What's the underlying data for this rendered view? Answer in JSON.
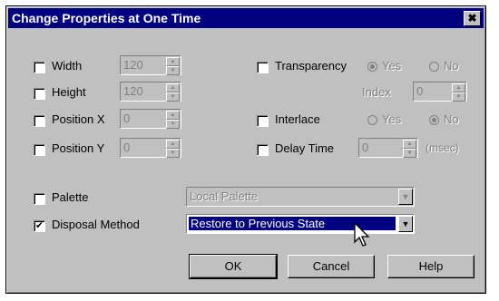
{
  "window": {
    "title": "Change Properties at One Time",
    "close_glyph": "✖"
  },
  "fields": {
    "width": {
      "label": "Width",
      "value": "120",
      "checked": false
    },
    "height": {
      "label": "Height",
      "value": "120",
      "checked": false
    },
    "position_x": {
      "label": "Position X",
      "value": "0",
      "checked": false
    },
    "position_y": {
      "label": "Position Y",
      "value": "0",
      "checked": false
    }
  },
  "transparency": {
    "label": "Transparency",
    "yes": "Yes",
    "no": "No",
    "selected": "Yes",
    "index_label": "Index",
    "index_value": "0",
    "checked": false
  },
  "interlace": {
    "label": "Interlace",
    "yes": "Yes",
    "no": "No",
    "selected": "No",
    "checked": false
  },
  "delay": {
    "label": "Delay Time",
    "value": "0",
    "unit": "(msec)",
    "checked": false
  },
  "palette": {
    "label": "Palette",
    "value": "Local Palette",
    "checked": false
  },
  "disposal": {
    "label": "Disposal Method",
    "value": "Restore to Previous State",
    "checked": true,
    "check_glyph": "✔"
  },
  "buttons": {
    "ok": "OK",
    "cancel": "Cancel",
    "help": "Help"
  }
}
